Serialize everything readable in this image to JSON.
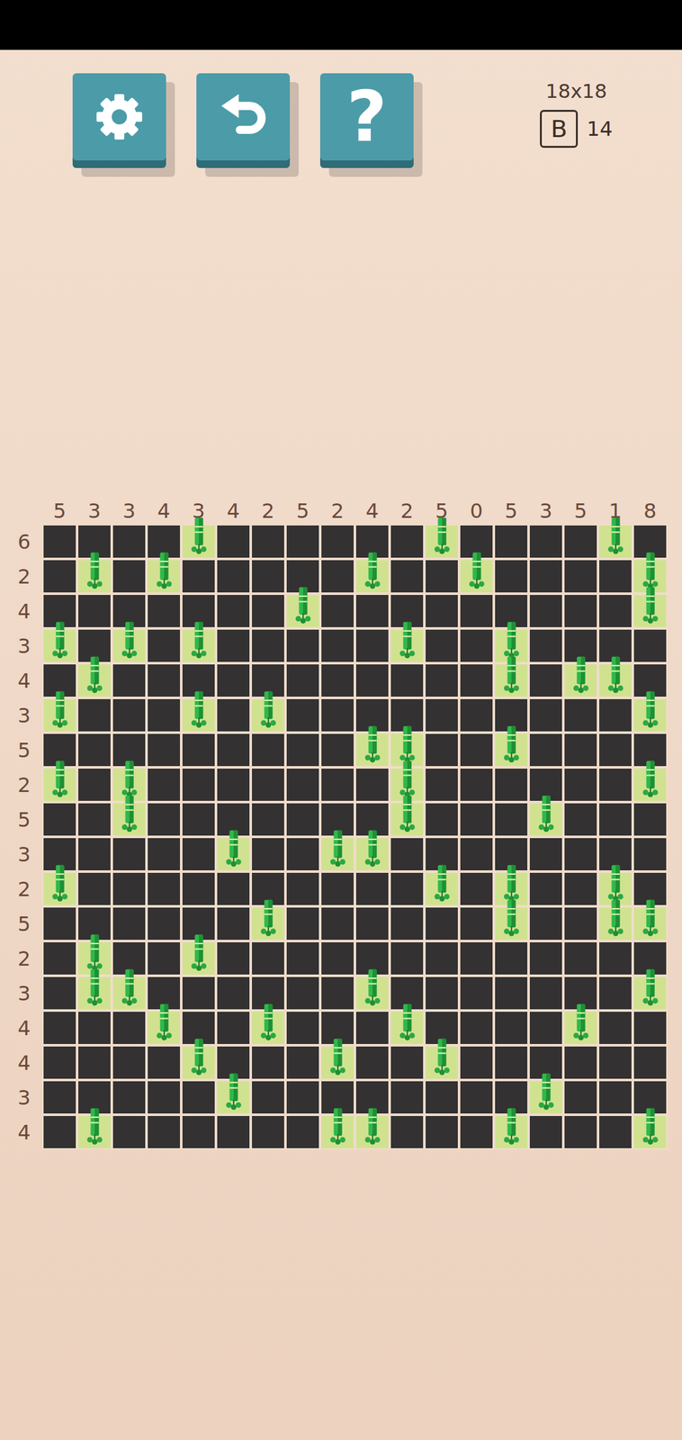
{
  "toolbar": {
    "help_glyph": "?"
  },
  "info": {
    "size": "18x18",
    "badge": "B",
    "count": "14"
  },
  "columns": [
    "5",
    "3",
    "3",
    "4",
    "3",
    "4",
    "2",
    "5",
    "2",
    "4",
    "2",
    "5",
    "0",
    "5",
    "3",
    "5",
    "1",
    "8"
  ],
  "rows": [
    {
      "clue": "6",
      "cells": [
        false,
        false,
        false,
        false,
        true,
        false,
        false,
        false,
        false,
        false,
        false,
        true,
        false,
        false,
        false,
        false,
        true,
        false
      ]
    },
    {
      "clue": "2",
      "cells": [
        false,
        true,
        false,
        true,
        false,
        false,
        false,
        false,
        false,
        true,
        false,
        false,
        true,
        false,
        false,
        false,
        false,
        true
      ]
    },
    {
      "clue": "4",
      "cells": [
        false,
        false,
        false,
        false,
        false,
        false,
        false,
        true,
        false,
        false,
        false,
        false,
        false,
        false,
        false,
        false,
        false,
        true
      ]
    },
    {
      "clue": "3",
      "cells": [
        true,
        false,
        true,
        false,
        true,
        false,
        false,
        false,
        false,
        false,
        true,
        false,
        false,
        true,
        false,
        false,
        false,
        false
      ]
    },
    {
      "clue": "4",
      "cells": [
        false,
        true,
        false,
        false,
        false,
        false,
        false,
        false,
        false,
        false,
        false,
        false,
        false,
        true,
        false,
        true,
        true,
        false
      ]
    },
    {
      "clue": "3",
      "cells": [
        true,
        false,
        false,
        false,
        true,
        false,
        true,
        false,
        false,
        false,
        false,
        false,
        false,
        false,
        false,
        false,
        false,
        true
      ]
    },
    {
      "clue": "5",
      "cells": [
        false,
        false,
        false,
        false,
        false,
        false,
        false,
        false,
        false,
        true,
        true,
        false,
        false,
        true,
        false,
        false,
        false,
        false
      ]
    },
    {
      "clue": "2",
      "cells": [
        true,
        false,
        true,
        false,
        false,
        false,
        false,
        false,
        false,
        false,
        true,
        false,
        false,
        false,
        false,
        false,
        false,
        true
      ]
    },
    {
      "clue": "5",
      "cells": [
        false,
        false,
        true,
        false,
        false,
        false,
        false,
        false,
        false,
        false,
        true,
        false,
        false,
        false,
        true,
        false,
        false,
        false
      ]
    },
    {
      "clue": "3",
      "cells": [
        false,
        false,
        false,
        false,
        false,
        true,
        false,
        false,
        true,
        true,
        false,
        false,
        false,
        false,
        false,
        false,
        false,
        false
      ]
    },
    {
      "clue": "2",
      "cells": [
        true,
        false,
        false,
        false,
        false,
        false,
        false,
        false,
        false,
        false,
        false,
        true,
        false,
        true,
        false,
        false,
        true,
        false
      ]
    },
    {
      "clue": "5",
      "cells": [
        false,
        false,
        false,
        false,
        false,
        false,
        true,
        false,
        false,
        false,
        false,
        false,
        false,
        true,
        false,
        false,
        true,
        true
      ]
    },
    {
      "clue": "2",
      "cells": [
        false,
        true,
        false,
        false,
        true,
        false,
        false,
        false,
        false,
        false,
        false,
        false,
        false,
        false,
        false,
        false,
        false,
        false
      ]
    },
    {
      "clue": "3",
      "cells": [
        false,
        true,
        true,
        false,
        false,
        false,
        false,
        false,
        false,
        true,
        false,
        false,
        false,
        false,
        false,
        false,
        false,
        true
      ]
    },
    {
      "clue": "4",
      "cells": [
        false,
        false,
        false,
        true,
        false,
        false,
        true,
        false,
        false,
        false,
        true,
        false,
        false,
        false,
        false,
        true,
        false,
        false
      ]
    },
    {
      "clue": "4",
      "cells": [
        false,
        false,
        false,
        false,
        true,
        false,
        false,
        false,
        true,
        false,
        false,
        true,
        false,
        false,
        false,
        false,
        false,
        false
      ]
    },
    {
      "clue": "3",
      "cells": [
        false,
        false,
        false,
        false,
        false,
        true,
        false,
        false,
        false,
        false,
        false,
        false,
        false,
        false,
        true,
        false,
        false,
        false
      ]
    },
    {
      "clue": "4",
      "cells": [
        false,
        true,
        false,
        false,
        false,
        false,
        false,
        false,
        true,
        true,
        false,
        false,
        false,
        true,
        false,
        false,
        false,
        true
      ]
    }
  ]
}
